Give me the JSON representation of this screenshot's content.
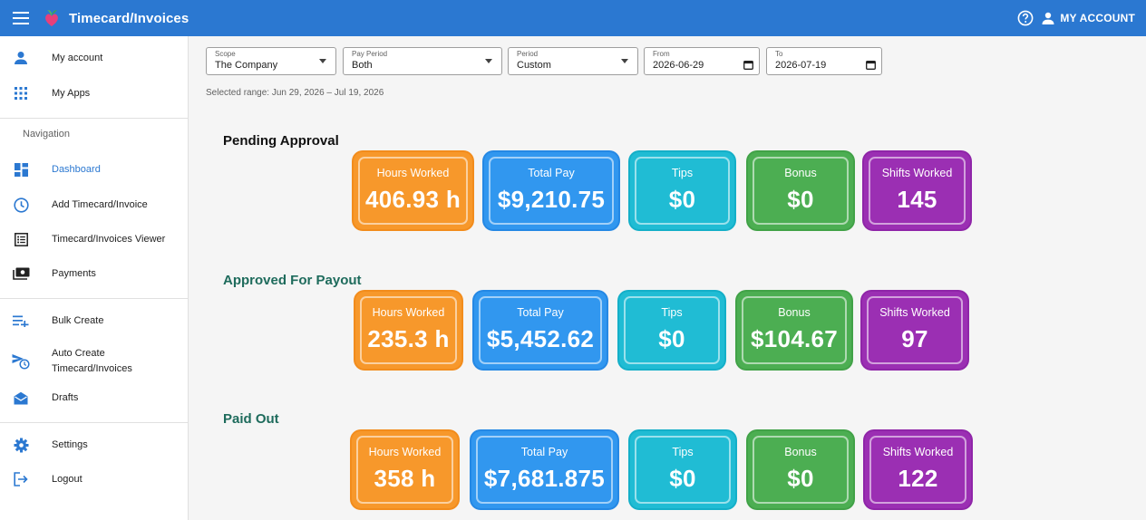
{
  "app": {
    "title": "Timecard/Invoices",
    "account_label": "MY ACCOUNT"
  },
  "sidebar": {
    "top_items": [
      {
        "label": "My account"
      },
      {
        "label": "My Apps"
      }
    ],
    "navigation_header": "Navigation",
    "nav_items": [
      {
        "label": "Dashboard"
      },
      {
        "label": "Add Timecard/Invoice"
      },
      {
        "label": "Timecard/Invoices Viewer"
      },
      {
        "label": "Payments"
      }
    ],
    "tool_items": [
      {
        "label": "Bulk Create"
      },
      {
        "label": "Auto Create Timecard/Invoices"
      },
      {
        "label": "Drafts"
      }
    ],
    "bottom_items": [
      {
        "label": "Settings"
      },
      {
        "label": "Logout"
      }
    ]
  },
  "filters": {
    "scope": {
      "label": "Scope",
      "value": "The Company"
    },
    "pay_period": {
      "label": "Pay Period",
      "value": "Both"
    },
    "period": {
      "label": "Period",
      "value": "Custom"
    },
    "from": {
      "label": "From",
      "value": "2026-06-29"
    },
    "to": {
      "label": "To",
      "value": "2026-07-19"
    },
    "selected_range": "Selected range: Jun 29, 2026 – Jul 19, 2026"
  },
  "sections": [
    {
      "title": "Pending Approval",
      "cards": [
        {
          "label": "Hours Worked",
          "value": "406.93 h"
        },
        {
          "label": "Total Pay",
          "value": "$9,210.75"
        },
        {
          "label": "Tips",
          "value": "$0"
        },
        {
          "label": "Bonus",
          "value": "$0"
        },
        {
          "label": "Shifts Worked",
          "value": "145"
        }
      ]
    },
    {
      "title": "Approved For Payout",
      "cards": [
        {
          "label": "Hours Worked",
          "value": "235.3 h"
        },
        {
          "label": "Total Pay",
          "value": "$5,452.62"
        },
        {
          "label": "Tips",
          "value": "$0"
        },
        {
          "label": "Bonus",
          "value": "$104.67"
        },
        {
          "label": "Shifts Worked",
          "value": "97"
        }
      ]
    },
    {
      "title": "Paid Out",
      "cards": [
        {
          "label": "Hours Worked",
          "value": "358 h"
        },
        {
          "label": "Total Pay",
          "value": "$7,681.875"
        },
        {
          "label": "Tips",
          "value": "$0"
        },
        {
          "label": "Bonus",
          "value": "$0"
        },
        {
          "label": "Shifts Worked",
          "value": "122"
        }
      ]
    }
  ],
  "colors": {
    "appbar": "#2b78d1",
    "hours": "#f7982b",
    "total_pay": "#3197ef",
    "tips": "#20bcd4",
    "bonus": "#4cae52",
    "shifts": "#9b2fb3"
  }
}
